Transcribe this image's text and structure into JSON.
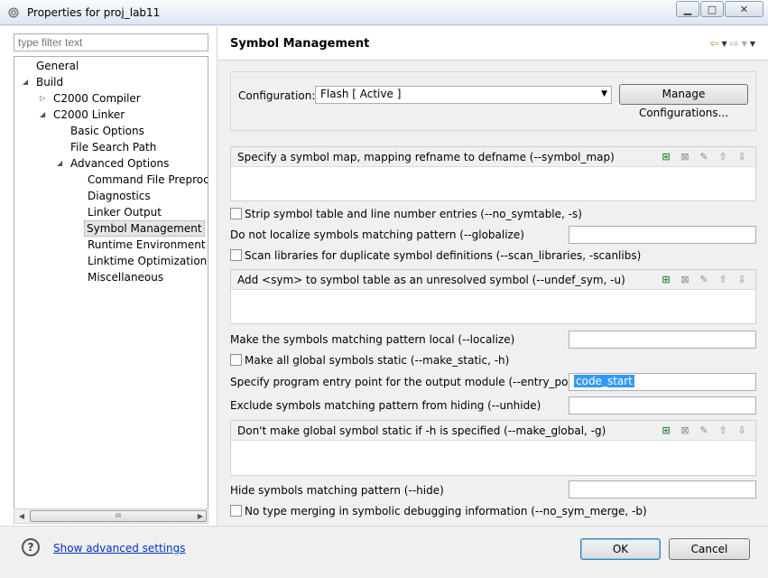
{
  "window": {
    "title": "Properties for proj_lab11",
    "controls": [
      "minimize",
      "maximize",
      "close"
    ]
  },
  "filter": {
    "placeholder": "type filter text"
  },
  "tree": [
    {
      "label": "General",
      "level": 0
    },
    {
      "label": "Build",
      "level": 0,
      "expanded": true
    },
    {
      "label": "C2000 Compiler",
      "level": 1,
      "expanded": false
    },
    {
      "label": "C2000 Linker",
      "level": 1,
      "expanded": true
    },
    {
      "label": "Basic Options",
      "level": 2
    },
    {
      "label": "File Search Path",
      "level": 2
    },
    {
      "label": "Advanced Options",
      "level": 2,
      "expanded": true
    },
    {
      "label": "Command File Preprocess",
      "level": 3
    },
    {
      "label": "Diagnostics",
      "level": 3
    },
    {
      "label": "Linker Output",
      "level": 3
    },
    {
      "label": "Symbol Management",
      "level": 3,
      "selected": true
    },
    {
      "label": "Runtime Environment",
      "level": 3
    },
    {
      "label": "Linktime Optimization",
      "level": 3
    },
    {
      "label": "Miscellaneous",
      "level": 3
    }
  ],
  "page": {
    "title": "Symbol Management",
    "config_label": "Configuration:",
    "config_value": "Flash  [ Active ]",
    "manage_button": "Manage Configurations..."
  },
  "lists": {
    "symbol_map": "Specify a symbol map, mapping refname to defname (--symbol_map)",
    "undef_sym": "Add <sym> to symbol table as an unresolved symbol (--undef_sym, -u)",
    "make_global": "Don't make global symbol static if -h is specified (--make_global, -g)"
  },
  "options": {
    "no_symtable": "Strip symbol table and line number entries (--no_symtable, -s)",
    "globalize": "Do not localize symbols matching pattern (--globalize)",
    "scan_libraries": "Scan libraries for duplicate symbol definitions (--scan_libraries, -scanlibs)",
    "localize": "Make the symbols matching pattern local (--localize)",
    "make_static": "Make all global symbols static (--make_static, -h)",
    "entry_point": "Specify program entry point for the output module (--entry_point, -e)",
    "entry_point_value": "code_start",
    "unhide": "Exclude symbols matching pattern from hiding (--unhide)",
    "hide": "Hide symbols matching pattern (--hide)",
    "no_sym_merge": "No type merging in symbolic debugging information (--no_sym_merge, -b)"
  },
  "footer": {
    "advanced_link": "Show advanced settings",
    "ok": "OK",
    "cancel": "Cancel"
  },
  "scrollbar_thumb": "III"
}
